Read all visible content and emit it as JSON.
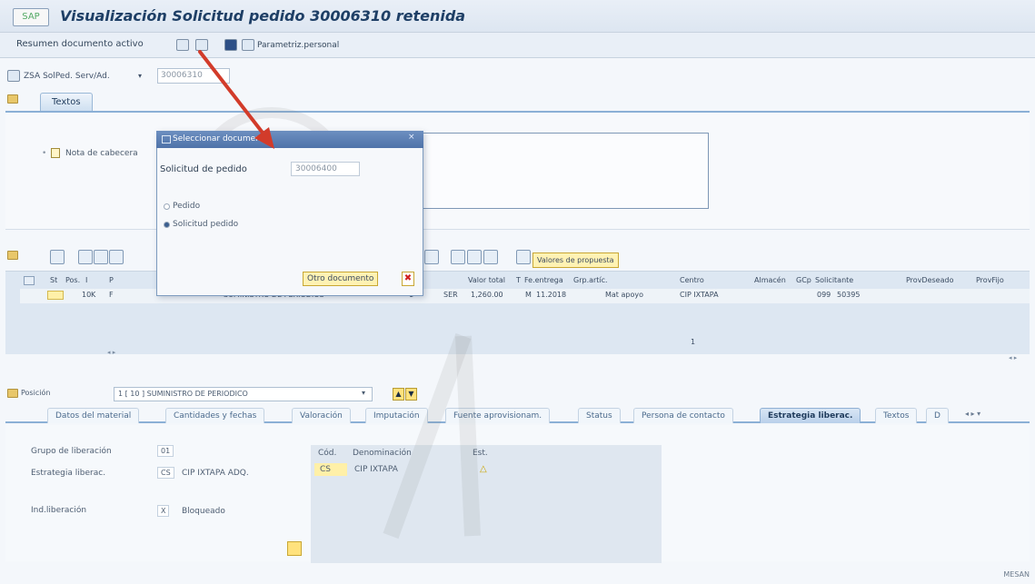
{
  "window": {
    "title": "Visualización Solicitud pedido 30006310 retenida",
    "icon_label": "SAP"
  },
  "toolbar": {
    "summary_label": "Resumen documento activo",
    "personal_label": "Parametriz.personal"
  },
  "doc": {
    "type": "ZSA SolPed. Serv/Ad.",
    "number": "30006310"
  },
  "top_tabs": [
    {
      "label": "Textos"
    }
  ],
  "texts_panel": {
    "header_note": "Nota de cabecera"
  },
  "items_toolbar": {
    "proposal_label": "Valores de propuesta"
  },
  "grid": {
    "headers": [
      "St",
      "Pos.",
      "I",
      "P",
      "",
      "Valor total",
      "T",
      "Fe.entrega",
      "Grp.artíc.",
      "Centro",
      "Almacén",
      "GCp",
      "Solicitante",
      "ProvDeseado",
      "ProvFijo"
    ],
    "row": {
      "pos": "10",
      "i": "K",
      "p": "F",
      "desc": "SUMINISTRO DE PERIODICO",
      "amt_unit": "1",
      "currency": "SER",
      "value": "1,260.00",
      "t": "M",
      "date": "11.2018",
      "group": "Mat apoyo",
      "center": "CIP IXTAPA",
      "gcp": "099",
      "requester": "50395"
    },
    "row_indicator": "1"
  },
  "item": {
    "label": "Posición",
    "selected": "1 [ 10 ] SUMINISTRO DE PERIODICO"
  },
  "item_tabs": [
    {
      "label": "Datos del material",
      "active": false
    },
    {
      "label": "Cantidades y fechas",
      "active": false
    },
    {
      "label": "Valoración",
      "active": false
    },
    {
      "label": "Imputación",
      "active": false
    },
    {
      "label": "Fuente aprovisionam.",
      "active": false
    },
    {
      "label": "Status",
      "active": false
    },
    {
      "label": "Persona de contacto",
      "active": false
    },
    {
      "label": "Estrategia liberac.",
      "active": true
    },
    {
      "label": "Textos",
      "active": false
    },
    {
      "label": "D",
      "active": false
    }
  ],
  "release": {
    "group_label": "Grupo de liberación",
    "group_value": "01",
    "strategy_label": "Estrategia liberac.",
    "strategy_code": "CS",
    "strategy_name": "CIP IXTAPA ADQ.",
    "ind_label": "Ind.liberación",
    "ind_code": "X",
    "ind_value": "Bloqueado",
    "table": {
      "headers": [
        "Cód.",
        "Denominación",
        "Est."
      ],
      "row": {
        "code": "CS",
        "name": "CIP IXTAPA",
        "status": "△"
      }
    }
  },
  "popup": {
    "title": "Seleccionar documento",
    "field_label": "Solicitud de pedido",
    "field_value": "30006400",
    "options": [
      {
        "label": "Pedido",
        "selected": false
      },
      {
        "label": "Solicitud pedido",
        "selected": true
      }
    ],
    "other_button": "Otro documento",
    "cancel_glyph": "✖"
  },
  "footer": {
    "text": "MESAN"
  },
  "colors": {
    "title": "#1e3f66",
    "arrow": "#d23b2a",
    "highlight": "#fff2b3"
  }
}
